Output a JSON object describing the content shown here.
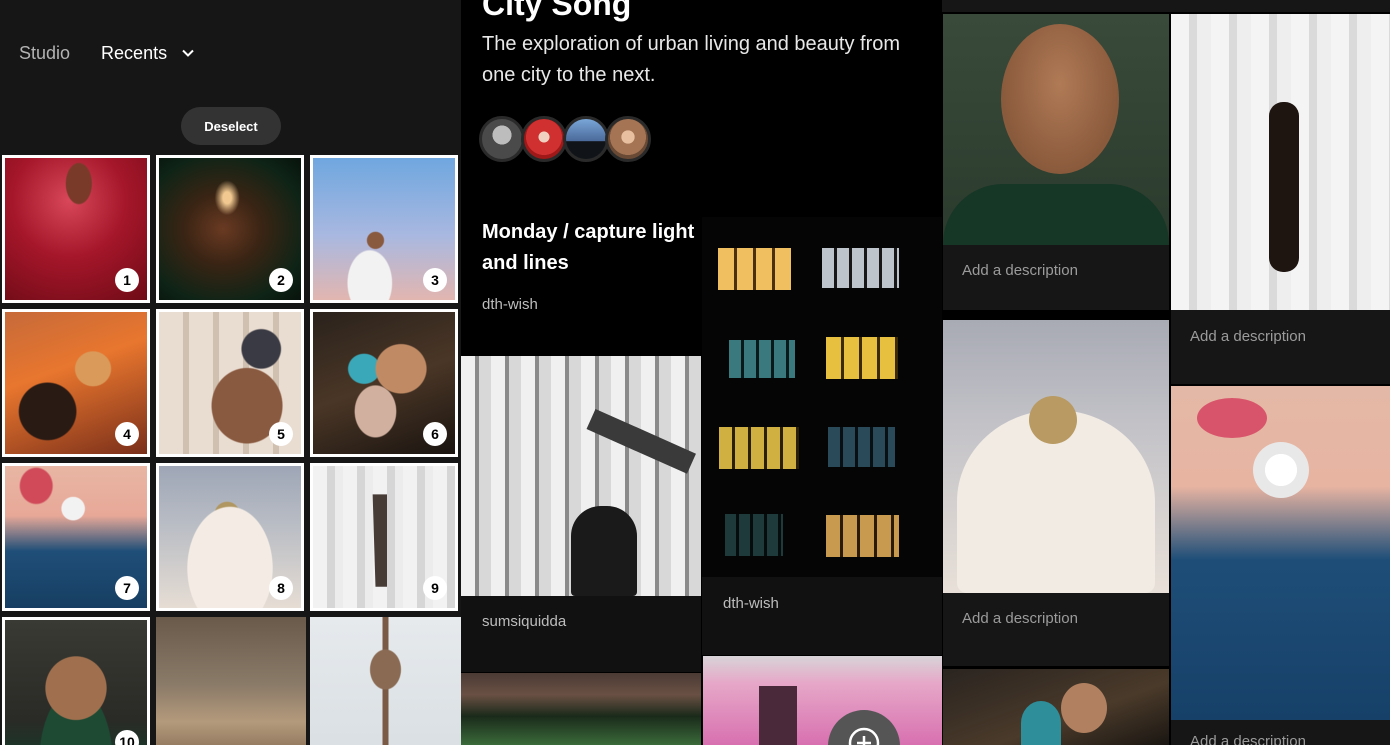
{
  "picker": {
    "nav_studio": "Studio",
    "nav_recents": "Recents",
    "deselect_label": "Deselect",
    "cells": [
      {
        "number": "1"
      },
      {
        "number": "2"
      },
      {
        "number": "3"
      },
      {
        "number": "4"
      },
      {
        "number": "5"
      },
      {
        "number": "6"
      },
      {
        "number": "7"
      },
      {
        "number": "8"
      },
      {
        "number": "9"
      },
      {
        "number": "10"
      }
    ]
  },
  "collection": {
    "title": "City Song",
    "description": "The exploration of urban living and beauty from one city to the next.",
    "prompt_title": "Monday / capture light and lines",
    "prompt_user": "dth-wish",
    "cards": [
      {
        "caption": "sumsiquidda"
      },
      {
        "caption": "dth-wish"
      }
    ]
  },
  "grid": {
    "desc_placeholder": "Add a description"
  },
  "colors": {
    "panel_bg": "#161616",
    "badge_bg": "#ffffff",
    "muted_text": "#9b9b9b"
  },
  "icons": [
    "chevron-down-icon",
    "plus-circle-icon"
  ]
}
